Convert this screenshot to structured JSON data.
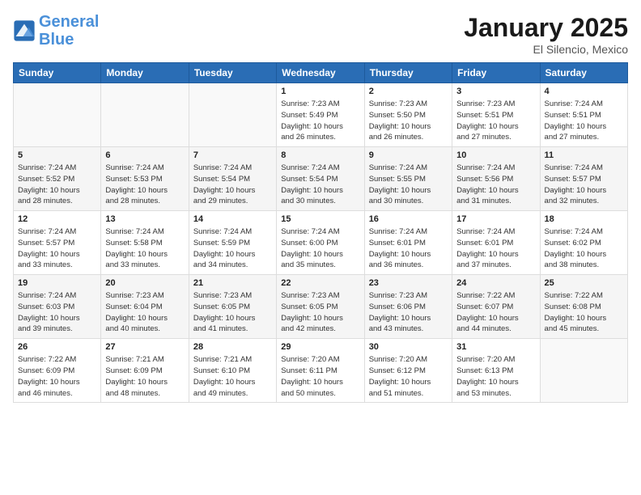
{
  "header": {
    "logo_general": "General",
    "logo_blue": "Blue",
    "title": "January 2025",
    "subtitle": "El Silencio, Mexico"
  },
  "days_of_week": [
    "Sunday",
    "Monday",
    "Tuesday",
    "Wednesday",
    "Thursday",
    "Friday",
    "Saturday"
  ],
  "weeks": [
    [
      {
        "day": "",
        "info": ""
      },
      {
        "day": "",
        "info": ""
      },
      {
        "day": "",
        "info": ""
      },
      {
        "day": "1",
        "info": "Sunrise: 7:23 AM\nSunset: 5:49 PM\nDaylight: 10 hours\nand 26 minutes."
      },
      {
        "day": "2",
        "info": "Sunrise: 7:23 AM\nSunset: 5:50 PM\nDaylight: 10 hours\nand 26 minutes."
      },
      {
        "day": "3",
        "info": "Sunrise: 7:23 AM\nSunset: 5:51 PM\nDaylight: 10 hours\nand 27 minutes."
      },
      {
        "day": "4",
        "info": "Sunrise: 7:24 AM\nSunset: 5:51 PM\nDaylight: 10 hours\nand 27 minutes."
      }
    ],
    [
      {
        "day": "5",
        "info": "Sunrise: 7:24 AM\nSunset: 5:52 PM\nDaylight: 10 hours\nand 28 minutes."
      },
      {
        "day": "6",
        "info": "Sunrise: 7:24 AM\nSunset: 5:53 PM\nDaylight: 10 hours\nand 28 minutes."
      },
      {
        "day": "7",
        "info": "Sunrise: 7:24 AM\nSunset: 5:54 PM\nDaylight: 10 hours\nand 29 minutes."
      },
      {
        "day": "8",
        "info": "Sunrise: 7:24 AM\nSunset: 5:54 PM\nDaylight: 10 hours\nand 30 minutes."
      },
      {
        "day": "9",
        "info": "Sunrise: 7:24 AM\nSunset: 5:55 PM\nDaylight: 10 hours\nand 30 minutes."
      },
      {
        "day": "10",
        "info": "Sunrise: 7:24 AM\nSunset: 5:56 PM\nDaylight: 10 hours\nand 31 minutes."
      },
      {
        "day": "11",
        "info": "Sunrise: 7:24 AM\nSunset: 5:57 PM\nDaylight: 10 hours\nand 32 minutes."
      }
    ],
    [
      {
        "day": "12",
        "info": "Sunrise: 7:24 AM\nSunset: 5:57 PM\nDaylight: 10 hours\nand 33 minutes."
      },
      {
        "day": "13",
        "info": "Sunrise: 7:24 AM\nSunset: 5:58 PM\nDaylight: 10 hours\nand 33 minutes."
      },
      {
        "day": "14",
        "info": "Sunrise: 7:24 AM\nSunset: 5:59 PM\nDaylight: 10 hours\nand 34 minutes."
      },
      {
        "day": "15",
        "info": "Sunrise: 7:24 AM\nSunset: 6:00 PM\nDaylight: 10 hours\nand 35 minutes."
      },
      {
        "day": "16",
        "info": "Sunrise: 7:24 AM\nSunset: 6:01 PM\nDaylight: 10 hours\nand 36 minutes."
      },
      {
        "day": "17",
        "info": "Sunrise: 7:24 AM\nSunset: 6:01 PM\nDaylight: 10 hours\nand 37 minutes."
      },
      {
        "day": "18",
        "info": "Sunrise: 7:24 AM\nSunset: 6:02 PM\nDaylight: 10 hours\nand 38 minutes."
      }
    ],
    [
      {
        "day": "19",
        "info": "Sunrise: 7:24 AM\nSunset: 6:03 PM\nDaylight: 10 hours\nand 39 minutes."
      },
      {
        "day": "20",
        "info": "Sunrise: 7:23 AM\nSunset: 6:04 PM\nDaylight: 10 hours\nand 40 minutes."
      },
      {
        "day": "21",
        "info": "Sunrise: 7:23 AM\nSunset: 6:05 PM\nDaylight: 10 hours\nand 41 minutes."
      },
      {
        "day": "22",
        "info": "Sunrise: 7:23 AM\nSunset: 6:05 PM\nDaylight: 10 hours\nand 42 minutes."
      },
      {
        "day": "23",
        "info": "Sunrise: 7:23 AM\nSunset: 6:06 PM\nDaylight: 10 hours\nand 43 minutes."
      },
      {
        "day": "24",
        "info": "Sunrise: 7:22 AM\nSunset: 6:07 PM\nDaylight: 10 hours\nand 44 minutes."
      },
      {
        "day": "25",
        "info": "Sunrise: 7:22 AM\nSunset: 6:08 PM\nDaylight: 10 hours\nand 45 minutes."
      }
    ],
    [
      {
        "day": "26",
        "info": "Sunrise: 7:22 AM\nSunset: 6:09 PM\nDaylight: 10 hours\nand 46 minutes."
      },
      {
        "day": "27",
        "info": "Sunrise: 7:21 AM\nSunset: 6:09 PM\nDaylight: 10 hours\nand 48 minutes."
      },
      {
        "day": "28",
        "info": "Sunrise: 7:21 AM\nSunset: 6:10 PM\nDaylight: 10 hours\nand 49 minutes."
      },
      {
        "day": "29",
        "info": "Sunrise: 7:20 AM\nSunset: 6:11 PM\nDaylight: 10 hours\nand 50 minutes."
      },
      {
        "day": "30",
        "info": "Sunrise: 7:20 AM\nSunset: 6:12 PM\nDaylight: 10 hours\nand 51 minutes."
      },
      {
        "day": "31",
        "info": "Sunrise: 7:20 AM\nSunset: 6:13 PM\nDaylight: 10 hours\nand 53 minutes."
      },
      {
        "day": "",
        "info": ""
      }
    ]
  ]
}
